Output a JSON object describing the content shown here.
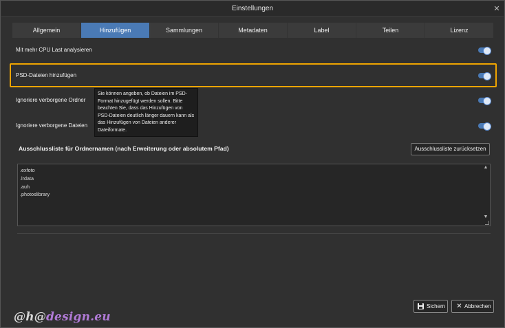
{
  "window": {
    "title": "Einstellungen"
  },
  "tabs": [
    {
      "label": "Allgemein"
    },
    {
      "label": "Hinzufügen"
    },
    {
      "label": "Sammlungen"
    },
    {
      "label": "Metadaten"
    },
    {
      "label": "Label"
    },
    {
      "label": "Teilen"
    },
    {
      "label": "Lizenz"
    }
  ],
  "active_tab": "Hinzufügen",
  "settings": [
    {
      "label": "Mit mehr CPU Last analysieren",
      "enabled": true
    },
    {
      "label": "PSD-Dateien hinzufügen",
      "enabled": true
    },
    {
      "label": "Ignoriere verborgene Ordner",
      "enabled": true
    },
    {
      "label": "Ignoriere verborgene Dateien",
      "enabled": true
    }
  ],
  "tooltip": {
    "text": "Sie können angeben, ob Dateien im PSD-Format hinzugefügt werden sollen. Bitte beachten Sie, dass das Hinzufügen von PSD-Dateien deutlich länger dauern kann als das Hinzufügen von Dateien anderer Dateiformate."
  },
  "exclusion": {
    "title": "Ausschlussliste für Ordnernamen (nach Erweiterung oder absolutem Pfad)",
    "reset_label": "Ausschlussliste zurücksetzen",
    "entries": [
      ".exfoto",
      ".lrdata",
      ".auh",
      ".photoslibrary"
    ]
  },
  "actions": {
    "save_label": "Sichern",
    "cancel_label": "Abbrechen"
  },
  "watermark": {
    "prefix": "@h@",
    "suffix": "design.eu"
  },
  "colors": {
    "accent": "#4a7ab5",
    "highlight": "#f0a500",
    "watermark_accent": "#b07ad6"
  }
}
